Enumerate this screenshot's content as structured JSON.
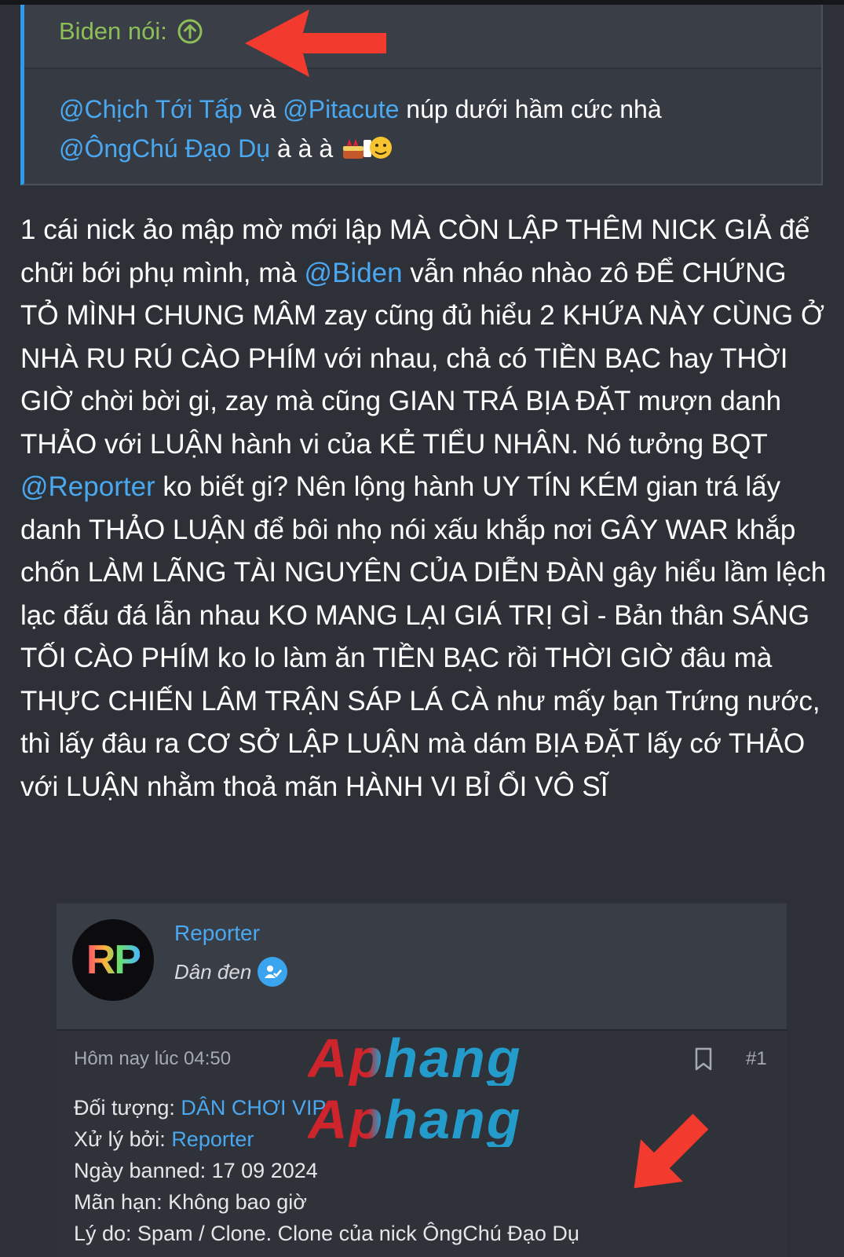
{
  "quote": {
    "author": "Biden nói:",
    "body": {
      "m1": "@Chịch Tới Tấp",
      "t1": " và ",
      "m2": "@Pitacute",
      "t2": " núp dưới hầm cức nhà ",
      "m3": "@ÔngChú Đạo Dụ",
      "t3": " à à à "
    }
  },
  "post": {
    "p1": "1 cái nick ảo mập mờ mới lập MÀ CÒN LẬP THÊM NICK GIẢ để chữi bới phụ mình, mà ",
    "m1": "@Biden",
    "p2": " vẫn nháo nhào zô ĐỂ CHỨNG TỎ MÌNH CHUNG MÂM zay cũng đủ hiểu 2 KHỨA NÀY CÙNG Ở NHÀ RU RÚ CÀO PHÍM với nhau, chả có TIỀN BẠC hay THỜI GIỜ chời bời gi, zay mà cũng GIAN TRÁ BỊA ĐẶT mượn danh THẢO với LUẬN hành vi của KẺ TIỂU NHÂN. Nó tưởng BQT ",
    "m2": "@Reporter",
    "p3": " ko biết gi? Nên lộng hành UY TÍN KÉM gian trá lấy danh THẢO LUẬN để bôi nhọ nói xấu khắp nơi GÂY WAR khắp chốn LÀM LÃNG TÀI NGUYÊN CỦA DIỄN ĐÀN gây hiểu lầm lệch lạc đấu đá lẫn nhau KO MANG LẠI GIÁ TRỊ GÌ - Bản thân SÁNG TỐI CÀO PHÍM ko lo làm ăn TIỀN BẠC rồi THỜI GIỜ đâu mà THỰC CHIẾN LÂM TRẬN SÁP LÁ CÀ như mấy bạn Trứng nước, thì lấy đâu ra CƠ SỞ LẬP LUẬN mà dám BỊA ĐẶT lấy cớ THẢO với LUẬN nhằm thoả mãn HÀNH VI BỈ ỔI VÔ SĨ"
  },
  "card": {
    "avatar_text": "RP",
    "name": "Reporter",
    "title": "Dân đen"
  },
  "ban": {
    "time": "Hôm nay lúc 04:50",
    "post_number": "#1",
    "l1_label": "Đối tượng: ",
    "l1_value": "DÂN CHƠI VIP",
    "l2_label": "Xử lý bởi: ",
    "l2_value": "Reporter",
    "l3": "Ngày banned: 17 09 2024",
    "l4": "Mãn hạn: Không bao giờ",
    "l5": "Lý do: Spam / Clone. Clone của nick ÔngChú Đạo Dụ"
  },
  "watermark": {
    "line1": "Aphang",
    "line2": "Aphang"
  },
  "colors": {
    "mention": "#4aa8f0",
    "author": "#8dbf58",
    "arrow": "#f23a2e",
    "background": "#2d3037"
  },
  "icons": [
    "arrow-up-circle-icon",
    "emoji-icon",
    "verified-icon",
    "bookmark-icon",
    "red-arrow-icon"
  ]
}
